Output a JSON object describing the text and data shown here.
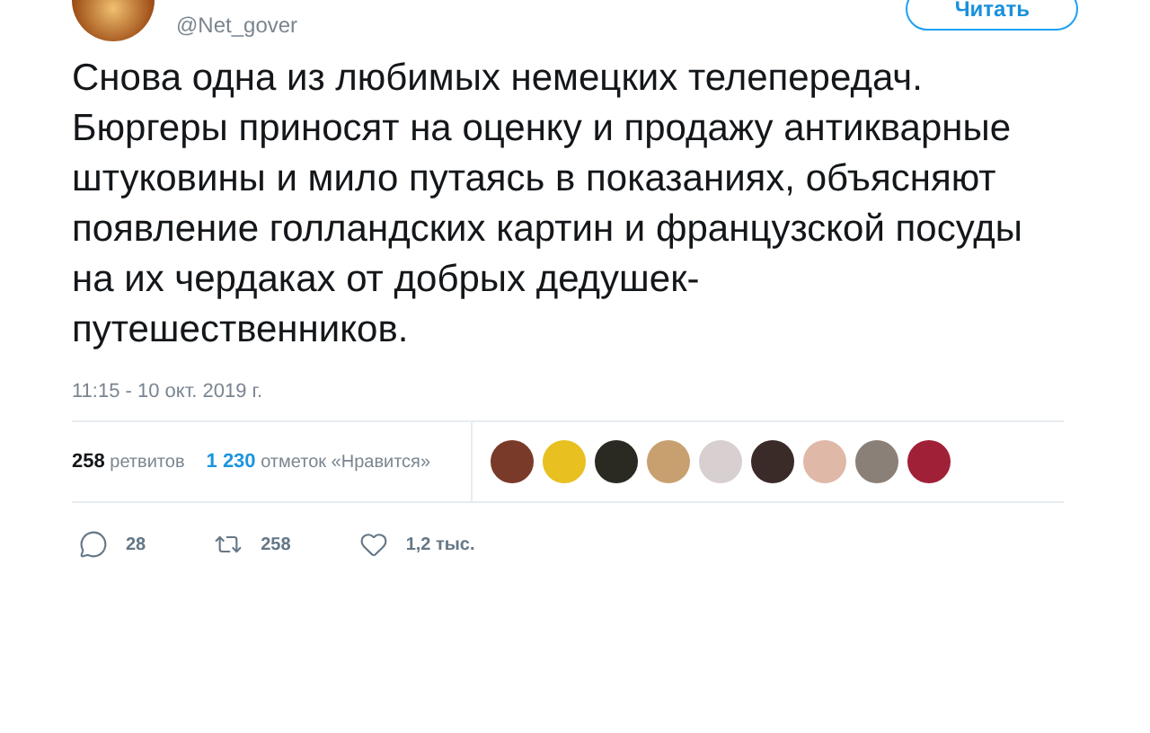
{
  "header": {
    "handle": "@Net_gover",
    "follow_button": "Читать"
  },
  "tweet": {
    "text": "Снова одна из любимых немецких телепередач. Бюргеры приносят на оценку и продажу антикварные штуковины и мило путаясь в показаниях, объясняют появление голландских картин и французской посуды на их чердаках от добрых дедушек-путешественников.",
    "timestamp": "11:15 - 10 окт. 2019 г."
  },
  "stats": {
    "retweets_count": "258",
    "retweets_label": "ретвитов",
    "likes_count": "1 230",
    "likes_label": "отметок «Нравится»"
  },
  "likers": [
    {
      "color": "#7a3a2a"
    },
    {
      "color": "#e8c020"
    },
    {
      "color": "#2a2a22"
    },
    {
      "color": "#c8a070"
    },
    {
      "color": "#d8d0d0"
    },
    {
      "color": "#3a2a28"
    },
    {
      "color": "#e0b8a8"
    },
    {
      "color": "#8a8078"
    },
    {
      "color": "#a02038"
    }
  ],
  "actions": [
    {
      "kind": "reply",
      "count": "28"
    },
    {
      "kind": "retweet",
      "count": "258"
    },
    {
      "kind": "like",
      "count": "1,2 тыс."
    }
  ]
}
